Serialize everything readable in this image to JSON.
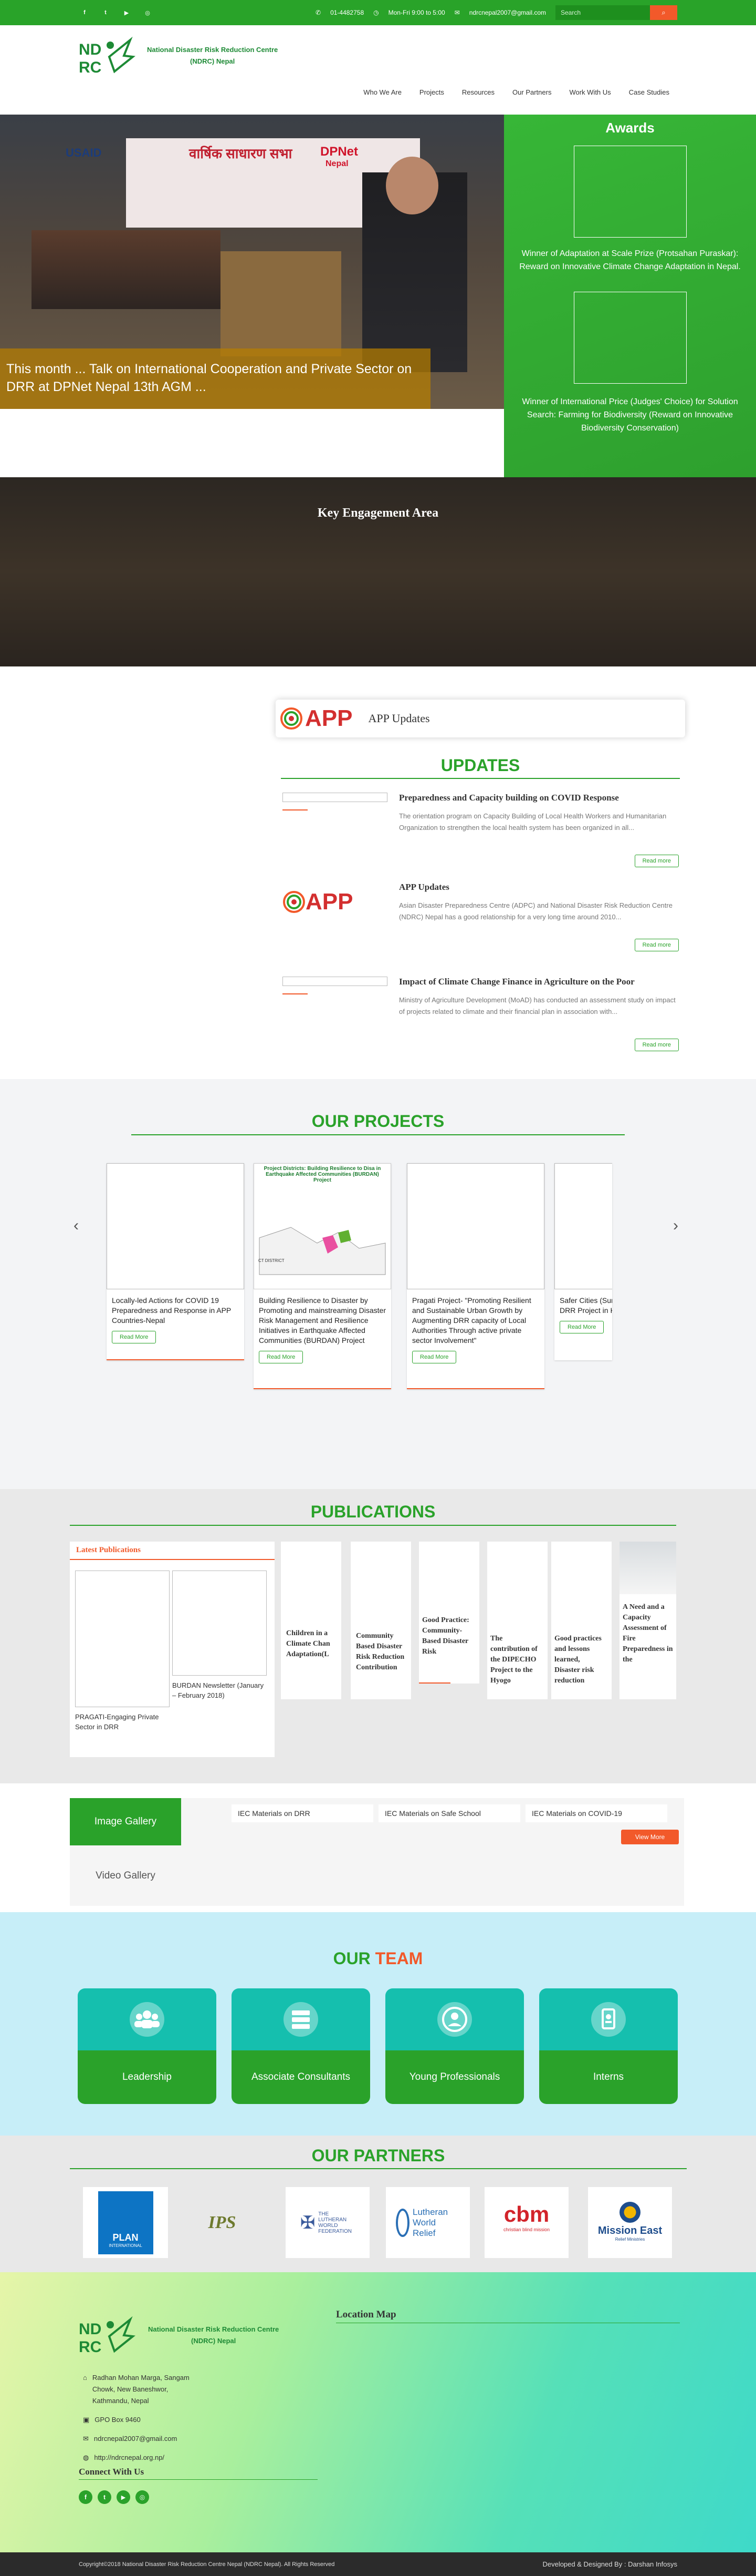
{
  "topbar": {
    "socials": [
      {
        "icon": "facebook-icon",
        "glyph": "f"
      },
      {
        "icon": "twitter-icon",
        "glyph": "t"
      },
      {
        "icon": "youtube-icon",
        "glyph": "▶"
      },
      {
        "icon": "instagram-icon",
        "glyph": "◎"
      }
    ],
    "phone": "01-4482758",
    "hours": "Mon-Fri 9:00 to 5:00",
    "email": "ndrcnepal2007@gmail.com",
    "search_placeholder": "Search"
  },
  "header": {
    "logo_line1": "National Disaster Risk Reduction Centre",
    "logo_line2": "(NDRC) Nepal",
    "nav": [
      "Who We Are",
      "Projects",
      "Resources",
      "Our Partners",
      "Work With Us",
      "Case Studies"
    ]
  },
  "hero": {
    "caption": "This month ... Talk on International Cooperation and Private Sector on DRR at DPNet Nepal 13th AGM ...",
    "banner_text_1": "DPNet",
    "banner_text_2": "Nepal",
    "banner_text_3": "USAID"
  },
  "awards": {
    "title": "Awards",
    "items": [
      "Winner of Adaptation at Scale Prize (Protsahan Puraskar): Reward on Innovative Climate Change Adaptation in Nepal.",
      "Winner of International Price (Judges' Choice) for Solution Search: Farming for Biodiversity (Reward on Innovative Biodiversity Conservation)"
    ]
  },
  "kea": {
    "title": "Key Engagement Area"
  },
  "updates": {
    "app_banner": "APP Updates",
    "app_logo": "APP",
    "title": "UPDATES",
    "items": [
      {
        "title": "Preparedness and Capacity building on COVID Response",
        "text": "The orientation program on Capacity Building of Local Health Workers and Humanitarian Organization to strengthen the local health system has been organized in all...",
        "btn": "Read more"
      },
      {
        "title": "APP Updates",
        "text": "Asian Disaster Preparedness Centre (ADPC) and National Disaster Risk Reduction Centre (NDRC) Nepal has a good relationship for a very long time around 2010...",
        "btn": "Read more"
      },
      {
        "title": "Impact of Climate Change Finance in Agriculture on the Poor",
        "text": "Ministry of Agriculture Development (MoAD) has conducted an assessment study on impact of projects related to climate and their financial plan in association with...",
        "btn": "Read more"
      }
    ]
  },
  "projects": {
    "title": "OUR PROJECTS",
    "map_title": "Project Districts: Building Resilience to Disa in Earthquake Affected Communities (BURDAN) Project",
    "map_district": "CT DISTRICT",
    "items": [
      {
        "title": "Locally-led Actions for COVID 19 Preparedness and Response in APP Countries-Nepal",
        "btn": "Read More"
      },
      {
        "title": "Building Resilience to Disaster by Promoting and mainstreaming Disaster Risk Management and Resilience Initiatives in Earthquake Affected Communities (BURDAN) Project",
        "btn": "Read More"
      },
      {
        "title": "Pragati Project- \"Promoting Resilient and Sustainable Urban Growth by Augmenting DRR capacity of Local Authorities Through active private sector Involvement\"",
        "btn": "Read More"
      },
      {
        "title": "Safer Cities (Surakshit Sah Urban DRR Project in Kath Valley",
        "btn": "Read More"
      }
    ]
  },
  "publications": {
    "title": "PUBLICATIONS",
    "latest_label": "Latest Publications",
    "latest": [
      {
        "title": "PRAGATI-Engaging Private Sector in DRR"
      },
      {
        "title": "BURDAN Newsletter (January – February 2018)"
      }
    ],
    "books": [
      "Children in a Climate Chan Adaptation(L",
      "Community Based Disaster Risk Reduction Contribution",
      "Good Practice: Community-Based Disaster Risk",
      "The contribution of the DIPECHO Project to the Hyogo",
      "Good practices and lessons learned, Disaster risk reduction",
      "A Need and a Capacity Assessment of Fire Preparedness in the"
    ]
  },
  "gallery": {
    "tabs": [
      "Image Gallery",
      "Video Gallery"
    ],
    "items": [
      "IEC Materials on DRR",
      "IEC Materials on Safe School",
      "IEC Materials on COVID-19"
    ],
    "view_more": "View More"
  },
  "team": {
    "title_our": "OUR",
    "title_team": "TEAM",
    "cards": [
      {
        "label": "Leadership",
        "icon": "group-icon"
      },
      {
        "label": "Associate Consultants",
        "icon": "server-icon"
      },
      {
        "label": "Young Professionals",
        "icon": "user-icon"
      },
      {
        "label": "Interns",
        "icon": "badge-icon"
      }
    ]
  },
  "partners": {
    "title": "OUR PARTNERS",
    "logos": [
      {
        "name": "PLAN",
        "sub": "INTERNATIONAL"
      },
      {
        "name": "IPS",
        "sub": ""
      },
      {
        "name": "THE LUTHERAN WORLD FEDERATION",
        "sub": ""
      },
      {
        "name": "Lutheran World Relief",
        "sub": ""
      },
      {
        "name": "cbm",
        "sub": "christian blind mission"
      },
      {
        "name": "Mission East",
        "sub": "Relief Ministries"
      }
    ]
  },
  "footer": {
    "logo_line1": "National Disaster Risk Reduction Centre",
    "logo_line2": "(NDRC) Nepal",
    "address": "Radhan Mohan Marga, Sangam Chowk, New Baneshwor, Kathmandu, Nepal",
    "pobox": "GPO Box 9460",
    "email": "ndrcnepal2007@gmail.com",
    "website": "http://ndrcnepal.org.np/",
    "connect": "Connect With Us",
    "location_title": "Location Map",
    "copyright": "Copyright©2018 National Disaster Risk Reduction Centre Nepal (NDRC Nepal). All Rights Reserved",
    "developer": "Developed & Designed By : Darshan Infosys"
  },
  "colors": {
    "green": "#29a329",
    "orange": "#f2592a",
    "teal": "#15bfae"
  }
}
